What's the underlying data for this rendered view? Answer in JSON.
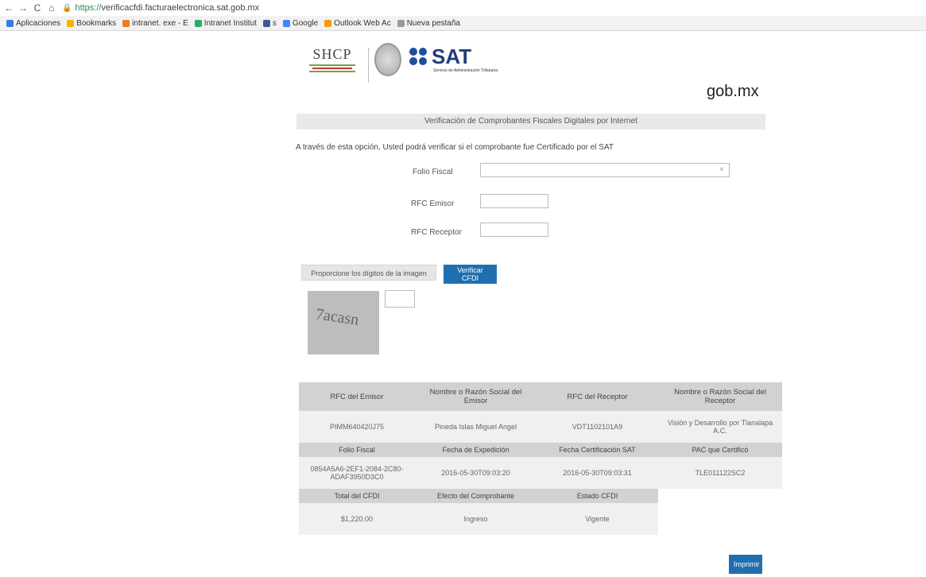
{
  "browser": {
    "url_scheme": "https://",
    "url_rest": "verificacfdi.facturaelectronica.sat.gob.mx",
    "bookmarks": [
      {
        "label": "Aplicaciones",
        "icon": "apps-grid-icon",
        "color": "#3b78e7"
      },
      {
        "label": "Bookmarks",
        "icon": "star-icon",
        "color": "#f4b400"
      },
      {
        "label": "intranet. exe - E",
        "icon": "site-icon",
        "color": "#e67e22"
      },
      {
        "label": "Intranet Institut",
        "icon": "site-icon",
        "color": "#27ae60"
      },
      {
        "label": "s",
        "icon": "facebook-icon",
        "color": "#3b5998"
      },
      {
        "label": "Google",
        "icon": "google-icon",
        "color": "#4285f4"
      },
      {
        "label": "Outlook Web Ac",
        "icon": "outlook-icon",
        "color": "#f39c12"
      },
      {
        "label": "Nueva pestaña",
        "icon": "page-icon",
        "color": "#999999"
      }
    ]
  },
  "header": {
    "shcp": "SHCP",
    "sat": "SAT",
    "sat_sub": "Servicio de Administración Tributaria",
    "gobmx": "gob.mx"
  },
  "title": "Verificación de Comprobantes Fiscales Digitales por Internet",
  "intro": "A través de esta opción, Usted podrá verificar si el comprobante fue Certificado por el SAT",
  "form": {
    "folio_label": "Folio Fiscal",
    "folio_value": "",
    "rfc_emisor_label": "RFC Emisor",
    "rfc_emisor_value": "",
    "rfc_receptor_label": "RFC Receptor",
    "rfc_receptor_value": "",
    "clear": "×"
  },
  "captcha": {
    "label": "Proporcione los dígitos de la imagen",
    "verify_button": "Verificar CFDI",
    "image_text": "7acasn",
    "value": ""
  },
  "results": {
    "h1": [
      "RFC del Emisor",
      "Nombre o Razón Social del Emisor",
      "RFC del Receptor",
      "Nombre o Razón Social del Receptor"
    ],
    "v1": [
      "PIMM640420J75",
      "Pineda Islas Miguel Angel",
      "VDT1102101A9",
      "Visión y Desarrollo por Tlanalapa A.C."
    ],
    "h2": [
      "Folio Fiscal",
      "Fecha de Expedición",
      "Fecha Certificación SAT",
      "PAC que Certificó"
    ],
    "v2": [
      "0854A5A6-2EF1-2084-2C80-ADAF3950D3C0",
      "2016-05-30T09:03:20",
      "2016-05-30T09:03:31",
      "TLE011122SC2"
    ],
    "h3": [
      "Total del CFDI",
      "Efecto del Comprobante",
      "Estado CFDI"
    ],
    "v3": [
      "$1,220.00",
      "Ingreso",
      "Vigente"
    ]
  },
  "print_button": "Imprimir",
  "colors": {
    "accent": "#1f6fb0",
    "sat_blue": "#1f3e7a"
  }
}
